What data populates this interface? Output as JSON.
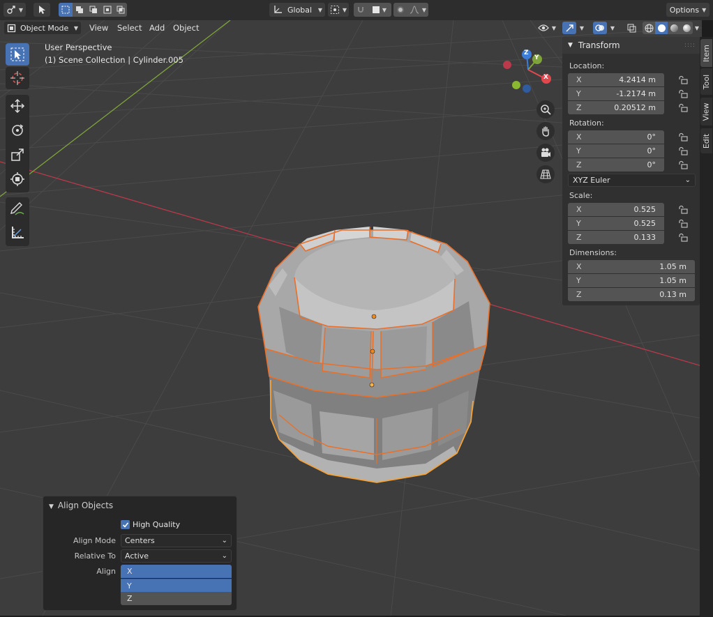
{
  "header": {
    "transform_orientation": "Global",
    "options_label": "Options",
    "mode": "Object Mode",
    "menus": [
      "View",
      "Select",
      "Add",
      "Object"
    ]
  },
  "viewport": {
    "perspective_label": "User Perspective",
    "collection_label": "(1) Scene Collection | Cylinder.005",
    "gizmo_axes": {
      "z": "Z",
      "y": "Y",
      "x": "X"
    }
  },
  "transform_panel": {
    "title": "Transform",
    "location_label": "Location:",
    "location": [
      {
        "axis": "X",
        "value": "4.2414 m"
      },
      {
        "axis": "Y",
        "value": "-1.2174 m"
      },
      {
        "axis": "Z",
        "value": "0.20512 m"
      }
    ],
    "rotation_label": "Rotation:",
    "rotation": [
      {
        "axis": "X",
        "value": "0°"
      },
      {
        "axis": "Y",
        "value": "0°"
      },
      {
        "axis": "Z",
        "value": "0°"
      }
    ],
    "rotation_mode": "XYZ Euler",
    "scale_label": "Scale:",
    "scale": [
      {
        "axis": "X",
        "value": "0.525"
      },
      {
        "axis": "Y",
        "value": "0.525"
      },
      {
        "axis": "Z",
        "value": "0.133"
      }
    ],
    "dimensions_label": "Dimensions:",
    "dimensions": [
      {
        "axis": "X",
        "value": "1.05 m"
      },
      {
        "axis": "Y",
        "value": "1.05 m"
      },
      {
        "axis": "Z",
        "value": "0.13 m"
      }
    ]
  },
  "side_tabs": [
    "Item",
    "Tool",
    "View",
    "Edit"
  ],
  "align_panel": {
    "title": "Align Objects",
    "high_quality_label": "High Quality",
    "align_mode_label": "Align Mode",
    "align_mode_value": "Centers",
    "relative_to_label": "Relative To",
    "relative_to_value": "Active",
    "align_label": "Align",
    "align_axes": [
      {
        "label": "X",
        "on": true
      },
      {
        "label": "Y",
        "on": true
      },
      {
        "label": "Z",
        "on": false
      }
    ]
  },
  "colors": {
    "accent": "#4772b3",
    "selection_outline": "#e8702a",
    "active_outline": "#f5a13a",
    "x_axis": "#b83a4b",
    "y_axis": "#7ea33b",
    "annotation_arrow": "#e0232a"
  }
}
